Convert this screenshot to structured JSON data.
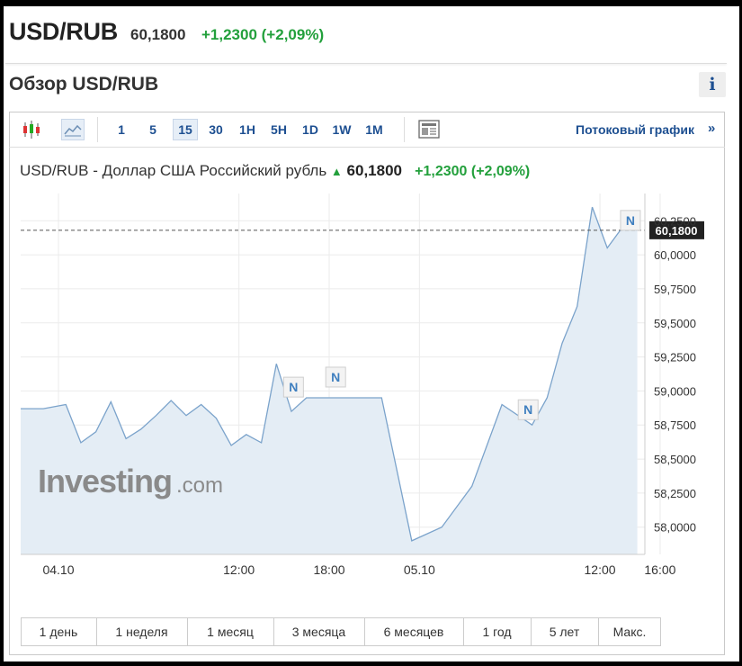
{
  "header": {
    "pair": "USD/RUB",
    "price": "60,1800",
    "change": "+1,2300 (+2,09%)"
  },
  "section": {
    "title": "Обзор USD/RUB",
    "info_label": "i"
  },
  "toolbar": {
    "timeframes": [
      "1",
      "5",
      "15",
      "30",
      "1H",
      "5H",
      "1D",
      "1W",
      "1M"
    ],
    "active_timeframe": "15",
    "stream_label": "Потоковый график",
    "stream_arrow": "»",
    "icons": [
      "candlestick-icon",
      "area-chart-icon",
      "news-layout-icon"
    ]
  },
  "chart": {
    "title": "USD/RUB - Доллар США Российский рубль",
    "title_arrow": "▲",
    "price": "60,1800",
    "change": "+1,2300 (+2,09%)",
    "watermark_main": "Investing",
    "watermark_suffix": ".com",
    "current_price_label": "60,1800",
    "news_marker": "N"
  },
  "ranges": [
    "1 день",
    "1 неделя",
    "1 месяц",
    "3 месяца",
    "6 месяцев",
    "1 год",
    "5 лет",
    "Макс."
  ],
  "colors": {
    "brand": "#1d4f91",
    "positive": "#23a03c",
    "line": "#7ba3cb",
    "fill": "#e4edf5"
  },
  "chart_data": {
    "type": "area",
    "x": [
      "04.10 00:00",
      "04.10 01:30",
      "04.10 03:00",
      "04.10 04:00",
      "04.10 05:00",
      "04.10 06:00",
      "04.10 07:00",
      "04.10 08:00",
      "04.10 09:00",
      "04.10 10:00",
      "04.10 11:00",
      "04.10 12:00",
      "04.10 13:00",
      "04.10 14:00",
      "04.10 15:00",
      "04.10 16:00",
      "04.10 17:00",
      "04.10 18:00",
      "04.10 19:00",
      "04.10 20:00",
      "04.10 22:00",
      "05.10 00:00",
      "05.10 02:00",
      "05.10 04:00",
      "05.10 06:00",
      "05.10 08:00",
      "05.10 10:00",
      "05.10 11:00",
      "05.10 12:00",
      "05.10 13:00",
      "05.10 14:00",
      "05.10 15:00",
      "05.10 16:00",
      "05.10 17:00"
    ],
    "values": [
      58.87,
      58.87,
      58.9,
      58.62,
      58.7,
      58.92,
      58.65,
      58.72,
      58.82,
      58.93,
      58.82,
      58.9,
      58.8,
      58.6,
      58.68,
      58.62,
      59.2,
      58.85,
      58.95,
      58.95,
      58.95,
      58.95,
      57.9,
      58.0,
      58.3,
      58.9,
      58.75,
      58.95,
      59.35,
      59.62,
      60.35,
      60.05,
      60.2,
      60.18
    ],
    "y_ticks": [
      "58,0000",
      "58,2500",
      "58,5000",
      "58,7500",
      "59,0000",
      "59,2500",
      "59,5000",
      "59,7500",
      "60,0000",
      "60,2500"
    ],
    "ylim": [
      57.8,
      60.45
    ],
    "x_ticks": [
      "04.10",
      "12:00",
      "18:00",
      "05.10",
      "12:00",
      "16:00"
    ],
    "current_value": 60.18,
    "grid": true
  }
}
